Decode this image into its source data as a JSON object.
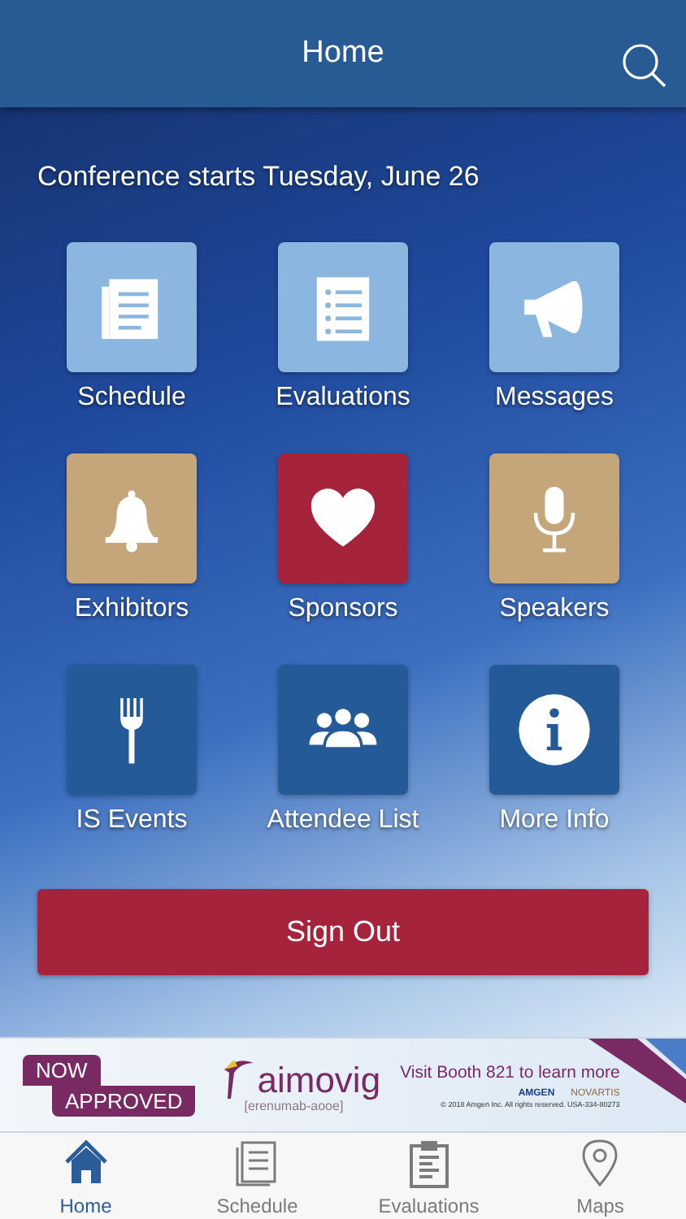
{
  "header": {
    "title": "Home"
  },
  "subtitle": "Conference starts Tuesday, June 26",
  "tiles": [
    {
      "label": "Schedule",
      "kind": "document",
      "color": "#8ab6e0"
    },
    {
      "label": "Evaluations",
      "kind": "list",
      "color": "#8ab6e0"
    },
    {
      "label": "Messages",
      "kind": "megaphone",
      "color": "#8ab6e0"
    },
    {
      "label": "Exhibitors",
      "kind": "bell",
      "color": "#c5a67b"
    },
    {
      "label": "Sponsors",
      "kind": "heart",
      "color": "#a5243c"
    },
    {
      "label": "Speakers",
      "kind": "microphone",
      "color": "#c5a67b"
    },
    {
      "label": "IS Events",
      "kind": "fork",
      "color": "#235a97"
    },
    {
      "label": "Attendee List",
      "kind": "people",
      "color": "#235a97"
    },
    {
      "label": "More Info",
      "kind": "info",
      "color": "#235a97"
    }
  ],
  "sign_out": "Sign Out",
  "banner": {
    "badge_top": "NOW",
    "badge_bottom": "APPROVED",
    "brand": "aimovig",
    "generic": "[erenumab-aooe]",
    "message": "Visit Booth 821 to learn more",
    "sponsor_1": "AMGEN",
    "sponsor_2": "NOVARTIS",
    "legal": "© 2018 Amgen Inc. All rights reserved. USA-334-80273"
  },
  "tab_bar": [
    {
      "label": "Home",
      "kind": "home",
      "selected": true
    },
    {
      "label": "Schedule",
      "kind": "document",
      "selected": false
    },
    {
      "label": "Evaluations",
      "kind": "clipboard",
      "selected": false
    },
    {
      "label": "Maps",
      "kind": "pin",
      "selected": false
    }
  ]
}
